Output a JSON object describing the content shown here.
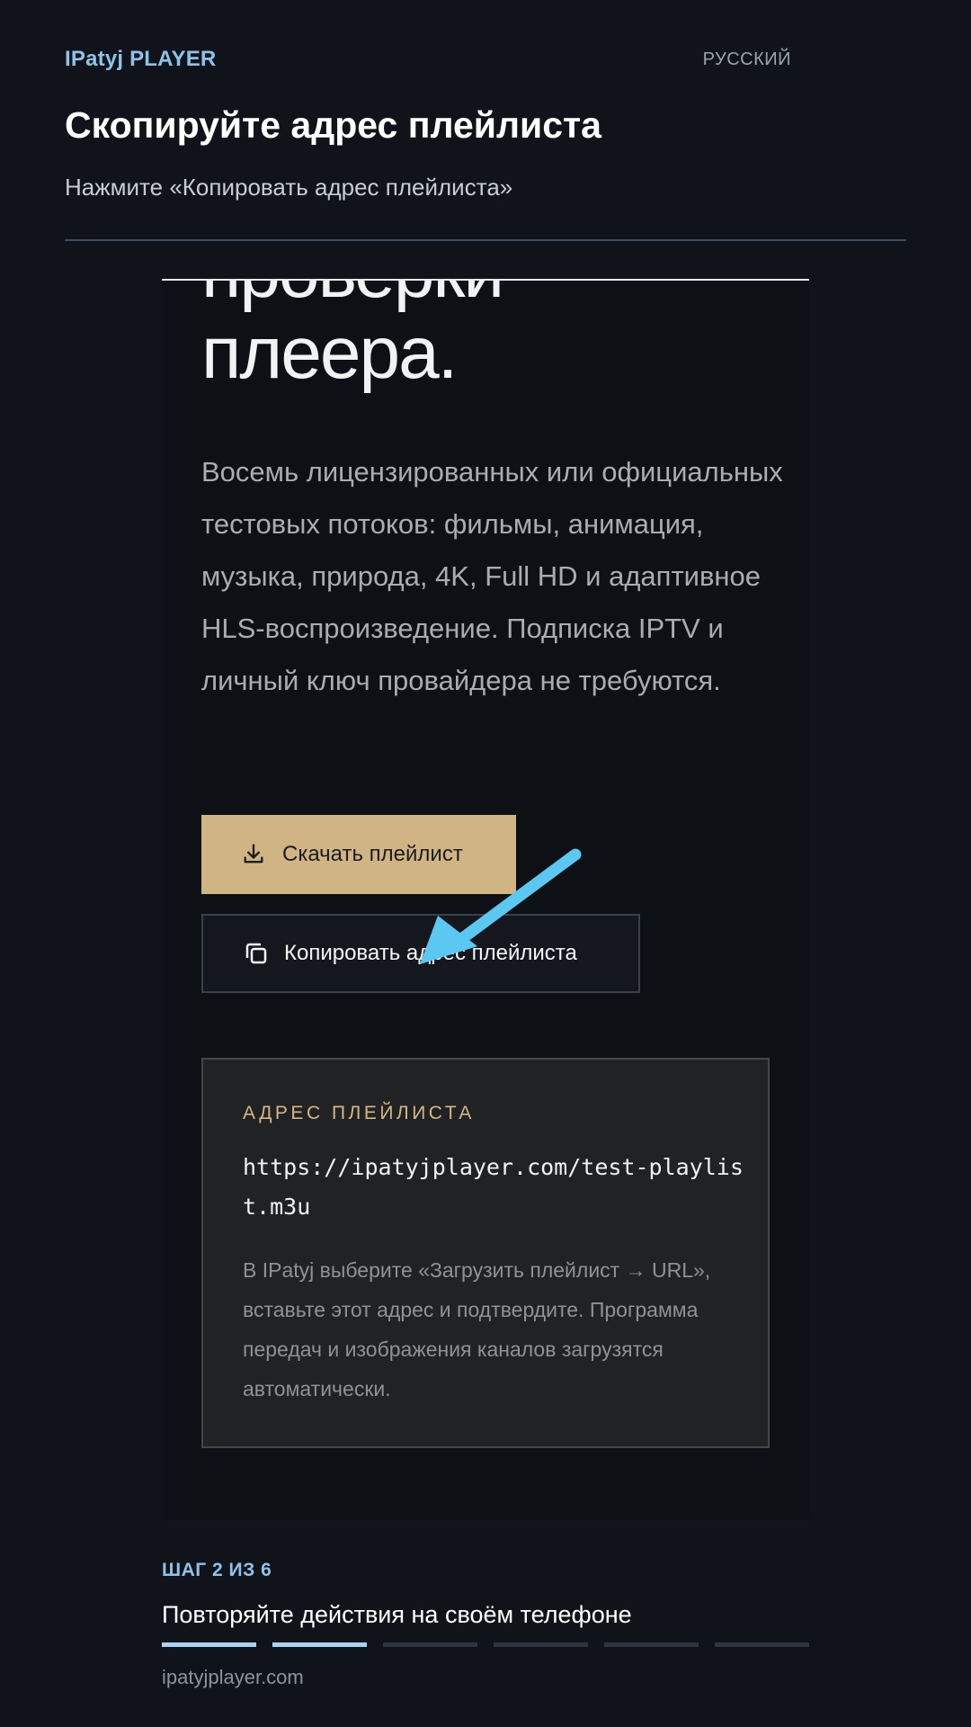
{
  "header": {
    "brand": "IPatyj PLAYER",
    "language": "РУССКИЙ",
    "title": "Скопируйте адрес плейлиста",
    "subtitle": "Нажмите «Копировать адрес плейлиста»"
  },
  "panel": {
    "hero_line1": "проверки",
    "hero_line2": "плеера.",
    "description": "Восемь лицензированных или официальных тестовых потоков: фильмы, анимация, музыка, природа, 4K, Full HD и адаптивное HLS-воспроизведение. Подписка IPTV и личный ключ провайдера не требуются.",
    "download_button": "Скачать плейлист",
    "copy_button": "Копировать адрес плейлиста",
    "address_box": {
      "label": "АДРЕС ПЛЕЙЛИСТА",
      "url": "https://ipatyjplayer.com/test-playlist.m3u",
      "note": "В IPatyj выберите «Загрузить плейлист → URL», вставьте этот адрес и подтвердите. Программа передач и изображения каналов загрузятся автоматически."
    }
  },
  "icons": {
    "download": "download-icon",
    "copy": "copy-icon",
    "pointer": "arrow-pointer-icon"
  },
  "colors": {
    "accent_blue": "#8fc2e6",
    "download_button_bg": "#d1b483",
    "arrow": "#5ac8f0",
    "address_label": "#d4b784"
  },
  "footer": {
    "step_label": "ШАГ 2 ИЗ 6",
    "step_title": "Повторяйте действия на своём телефоне",
    "steps_total": 6,
    "steps_completed": 2,
    "domain": "ipatyjplayer.com"
  }
}
